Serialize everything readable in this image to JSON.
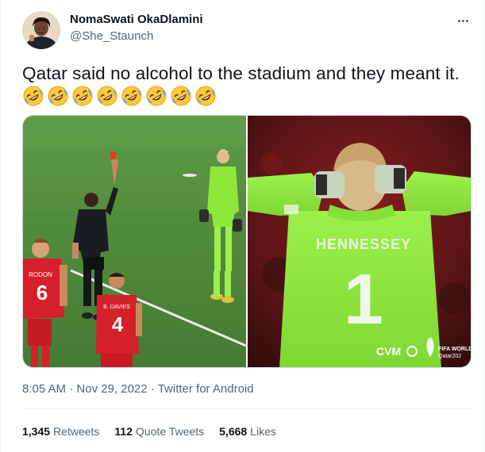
{
  "author": {
    "display_name": "NomaSwati OkaDlamini",
    "handle": "@She_Staunch"
  },
  "tweet": {
    "text": "Qatar said no alcohol to the stadium and they meant it.",
    "emoji": "rolling-on-the-floor-laughing",
    "emoji_count": 8
  },
  "media": {
    "left_photo": {
      "shirt_numbers": [
        "6",
        "4"
      ],
      "shirt_names": [
        "RODON",
        "B. DAVIES"
      ]
    },
    "right_photo": {
      "shirt_name": "HENNESSEY",
      "shirt_number": "1",
      "watermark_broadcaster": "CVM",
      "watermark_tournament": "FIFA WORLD Qatar202"
    }
  },
  "meta": {
    "time": "8:05 AM",
    "date": "Nov 29, 2022",
    "source": "Twitter for Android"
  },
  "stats": {
    "retweets_count": "1,345",
    "retweets_label": "Retweets",
    "quotes_count": "112",
    "quotes_label": "Quote Tweets",
    "likes_count": "5,668",
    "likes_label": "Likes"
  },
  "colors": {
    "text_primary": "#0f1419",
    "text_secondary": "#536471",
    "divider": "#eff3f4",
    "pitch_green": "#4f8a3a",
    "goalkeeper_kit": "#8ee83a",
    "wales_red": "#d51f2a"
  }
}
